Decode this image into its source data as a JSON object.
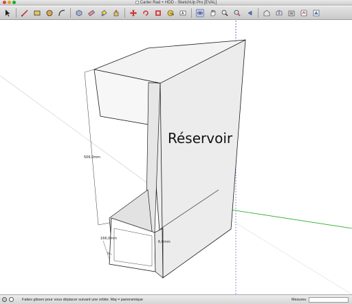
{
  "window": {
    "title": "Carter Rad + HDD - SketchUp Pro [ÉVAL]"
  },
  "toolbar": {
    "tools": [
      {
        "name": "select-tool-icon",
        "active": false
      },
      {
        "name": "pencil-line-tool-icon",
        "active": false
      },
      {
        "name": "rectangle-tool-icon",
        "active": false
      },
      {
        "name": "circle-tool-icon",
        "active": false
      },
      {
        "name": "arc-tool-icon",
        "active": false
      },
      {
        "name": "make-component-icon",
        "active": false
      },
      {
        "name": "eraser-tool-icon",
        "active": false
      },
      {
        "name": "paint-bucket-tool-icon",
        "active": false
      },
      {
        "name": "push-pull-tool-icon",
        "active": false
      },
      {
        "name": "move-tool-icon",
        "active": false
      },
      {
        "name": "rotate-tool-icon",
        "active": false
      },
      {
        "name": "offset-tool-icon",
        "active": false
      },
      {
        "name": "tape-measure-tool-icon",
        "active": false
      },
      {
        "name": "text-tool-icon",
        "active": false
      },
      {
        "name": "orbit-tool-icon",
        "active": true
      },
      {
        "name": "pan-tool-icon",
        "active": false
      },
      {
        "name": "zoom-tool-icon",
        "active": false
      },
      {
        "name": "zoom-extents-tool-icon",
        "active": false
      },
      {
        "name": "previous-view-icon",
        "active": false
      },
      {
        "name": "3d-warehouse-icon",
        "active": false
      },
      {
        "name": "share-model-icon",
        "active": false
      },
      {
        "name": "get-components-icon",
        "active": false
      },
      {
        "name": "extension-warehouse-icon",
        "active": false
      },
      {
        "name": "layout-send-icon",
        "active": false
      }
    ]
  },
  "model": {
    "label_text": "Réservoir",
    "dimension_height": "506,0mm",
    "dimension_width": "166,0mm",
    "dimension_depth": "6,0mm",
    "dimension_small": "5"
  },
  "colors": {
    "face_light": "#f2f2f2",
    "face_front": "#dcdcdc",
    "face_top": "#efefef",
    "face_shade": "#e4e4e4",
    "edge": "#1a1a1a",
    "axis_red": "#cc2222",
    "axis_green": "#22aa22",
    "axis_blue": "#3344cc"
  },
  "status": {
    "message": "Faites glisser pour vous déplacer suivant une orbite.  Maj = panoramique",
    "measure_label": "Mesures",
    "measure_value": ""
  }
}
